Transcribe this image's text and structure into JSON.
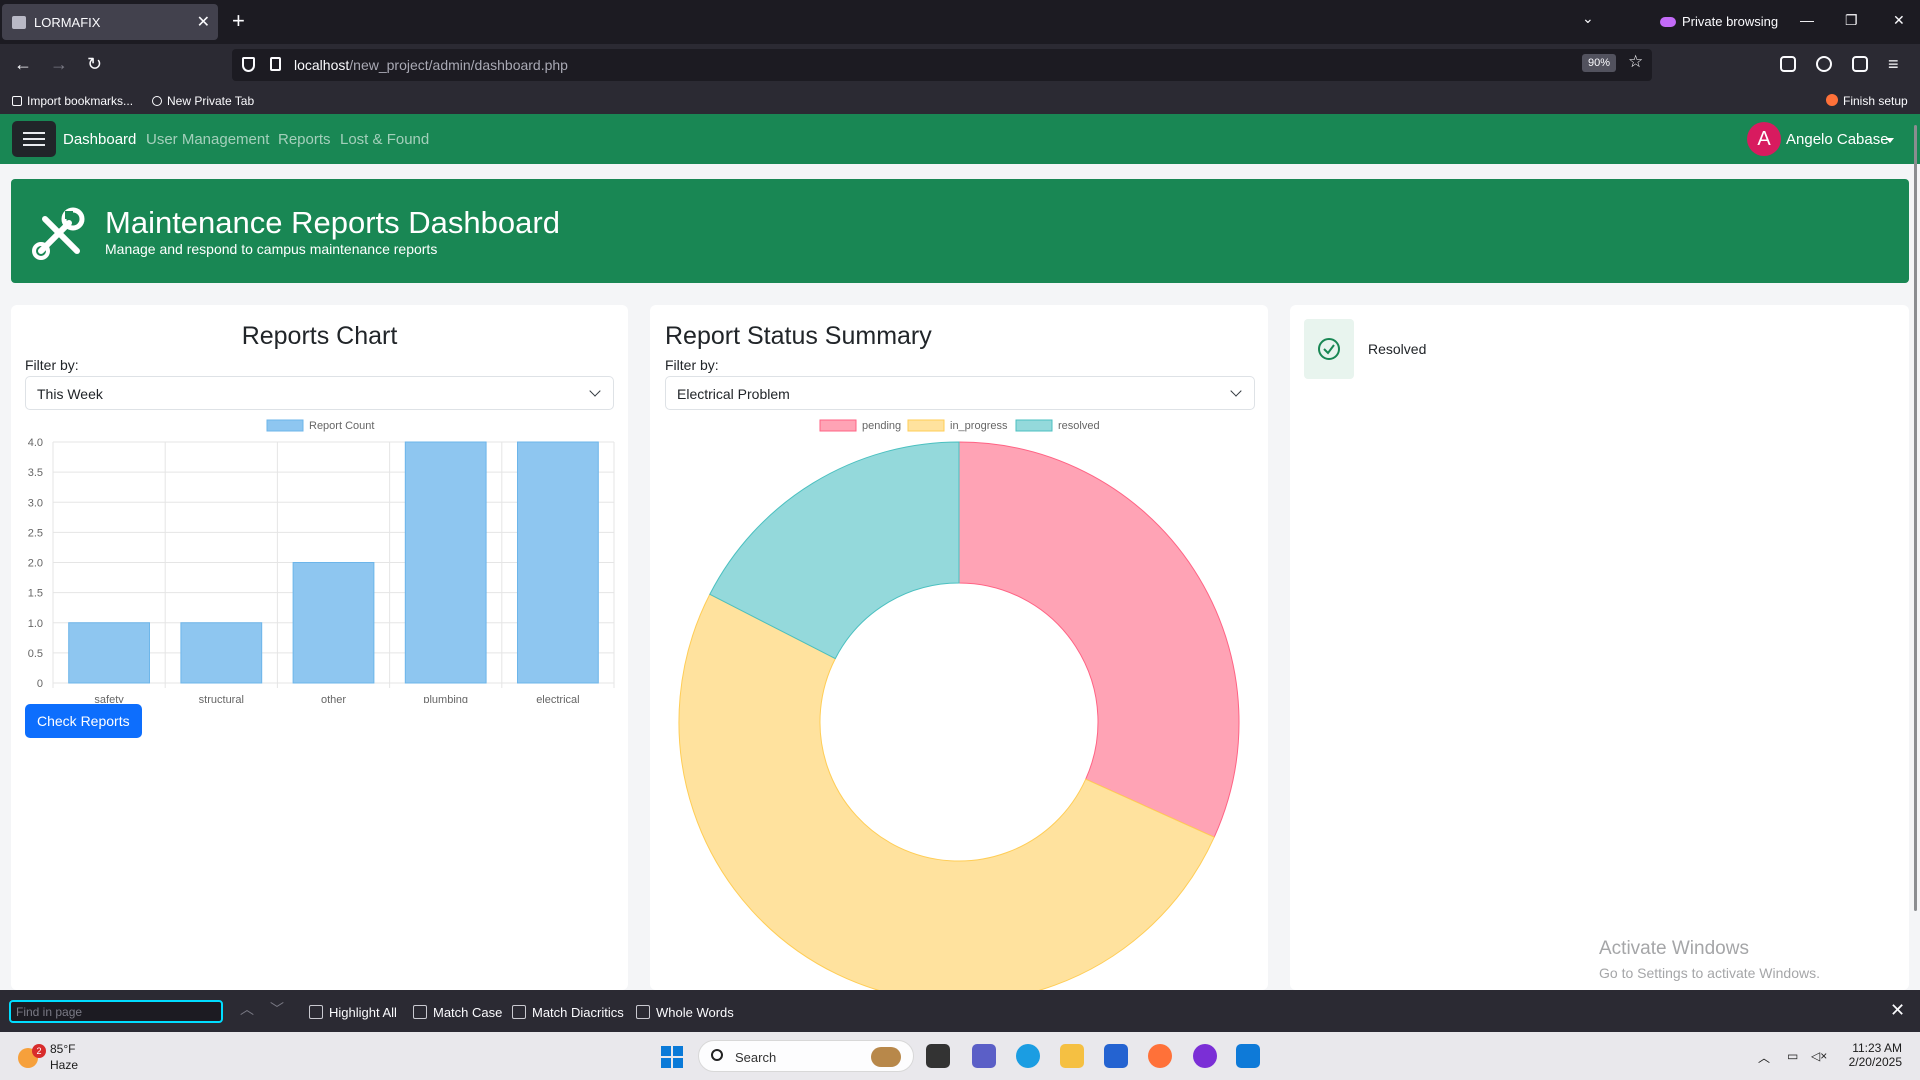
{
  "browser": {
    "tab_title": "LORMAFIX",
    "private_label": "Private browsing",
    "url_host": "localhost",
    "url_path": "/new_project/admin/dashboard.php",
    "zoom": "90%",
    "bookmarks": [
      "Import bookmarks...",
      "New Private Tab"
    ],
    "finish_setup": "Finish setup"
  },
  "nav": {
    "links": [
      "Dashboard",
      "User Management",
      "Reports",
      "Lost & Found"
    ],
    "avatar_initial": "A",
    "user_name": "Angelo Cabase"
  },
  "hero": {
    "title": "Maintenance Reports Dashboard",
    "subtitle": "Manage and respond to campus maintenance reports"
  },
  "reports_card": {
    "title": "Reports Chart",
    "filter_label": "Filter by:",
    "filter_value": "This Week",
    "button_label": "Check Reports"
  },
  "status_card": {
    "title": "Report Status Summary",
    "filter_label": "Filter by:",
    "filter_value": "Electrical Problem"
  },
  "resolved_card": {
    "label": "Resolved"
  },
  "watermark": {
    "line1": "Activate Windows",
    "line2": "Go to Settings to activate Windows."
  },
  "findbar": {
    "placeholder": "Find in page",
    "options": [
      "Highlight All",
      "Match Case",
      "Match Diacritics",
      "Whole Words"
    ]
  },
  "taskbar": {
    "temp": "85°F",
    "condition": "Haze",
    "weather_badge": "2",
    "search_label": "Search",
    "time": "11:23 AM",
    "date": "2/20/2025"
  },
  "chart_data": [
    {
      "type": "bar",
      "categories": [
        "safety",
        "structural",
        "other",
        "plumbing",
        "electrical"
      ],
      "series": [
        {
          "name": "Report Count",
          "values": [
            1,
            1,
            2,
            4,
            4
          ]
        }
      ],
      "ylim": [
        0,
        4
      ],
      "y_ticks": [
        "0",
        "0.5",
        "1.0",
        "1.5",
        "2.0",
        "2.5",
        "3.0",
        "3.5",
        "4.0"
      ],
      "legend": "top-center",
      "grid": true,
      "colors": {
        "fill": "#8ec6f0",
        "stroke": "#6cb5ea"
      }
    },
    {
      "type": "pie",
      "style": "doughnut",
      "labels": [
        "pending",
        "in_progress",
        "resolved"
      ],
      "values": [
        1,
        1.6,
        0.55
      ],
      "colors": [
        "#ffa3b5",
        "#ffe29e",
        "#94d9db"
      ],
      "borders": [
        "#ff6384",
        "#ffcd56",
        "#4bc0c0"
      ],
      "legend": "top-center"
    }
  ]
}
